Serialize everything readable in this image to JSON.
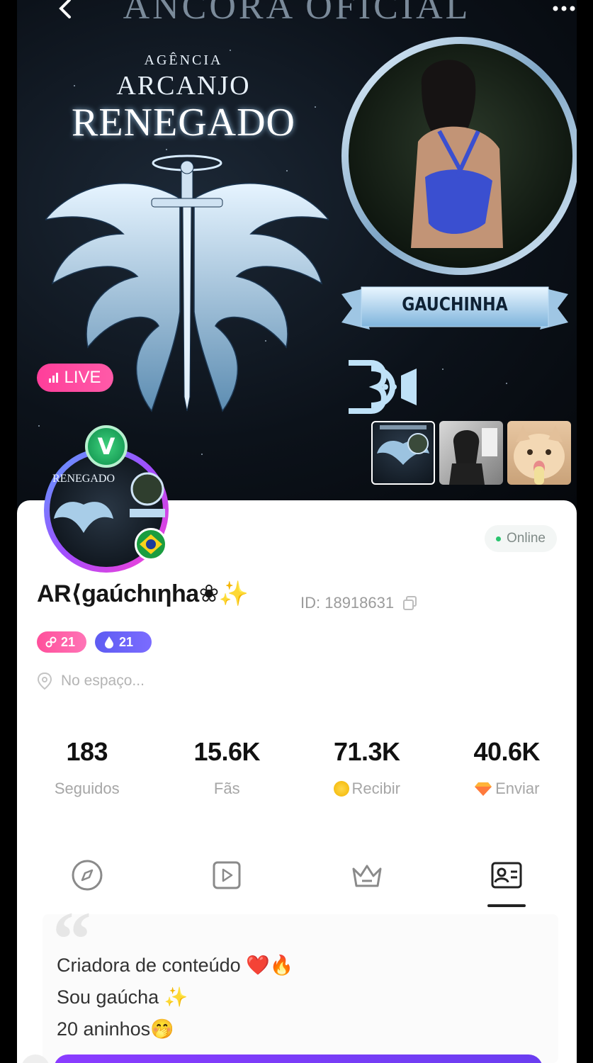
{
  "banner": {
    "title": "ANCORA OFICIAL",
    "agency_line1": "AGÊNCIA",
    "agency_line2": "ARCANJO",
    "agency_line3": "RENEGADO",
    "ribbon_name": "GAUCHINHA",
    "live_label": "LIVE"
  },
  "profile": {
    "username": "AR⟨gaúchιηha❀✨",
    "id_label": "ID: 18918631",
    "status": "Online",
    "badge_level_1": "21",
    "badge_level_2": "21",
    "location": "No espaço..."
  },
  "stats": [
    {
      "value": "183",
      "label": "Seguidos"
    },
    {
      "value": "15.6K",
      "label": "Fãs"
    },
    {
      "value": "71.3K",
      "label": "Recibir"
    },
    {
      "value": "40.6K",
      "label": "Enviar"
    }
  ],
  "tabs": [
    "compass-icon",
    "video-icon",
    "crown-icon",
    "profile-card-icon"
  ],
  "bio": {
    "line1": "Criadora de conteúdo ❤️🔥",
    "line2": "Sou gaúcha ✨",
    "line3": "20 aninhos🤭"
  },
  "colors": {
    "live_pink": "#ff3e9a",
    "badge_blue": "#5e5cf2",
    "online_green": "#29c46e",
    "primary_purple": "#8a3cff"
  }
}
